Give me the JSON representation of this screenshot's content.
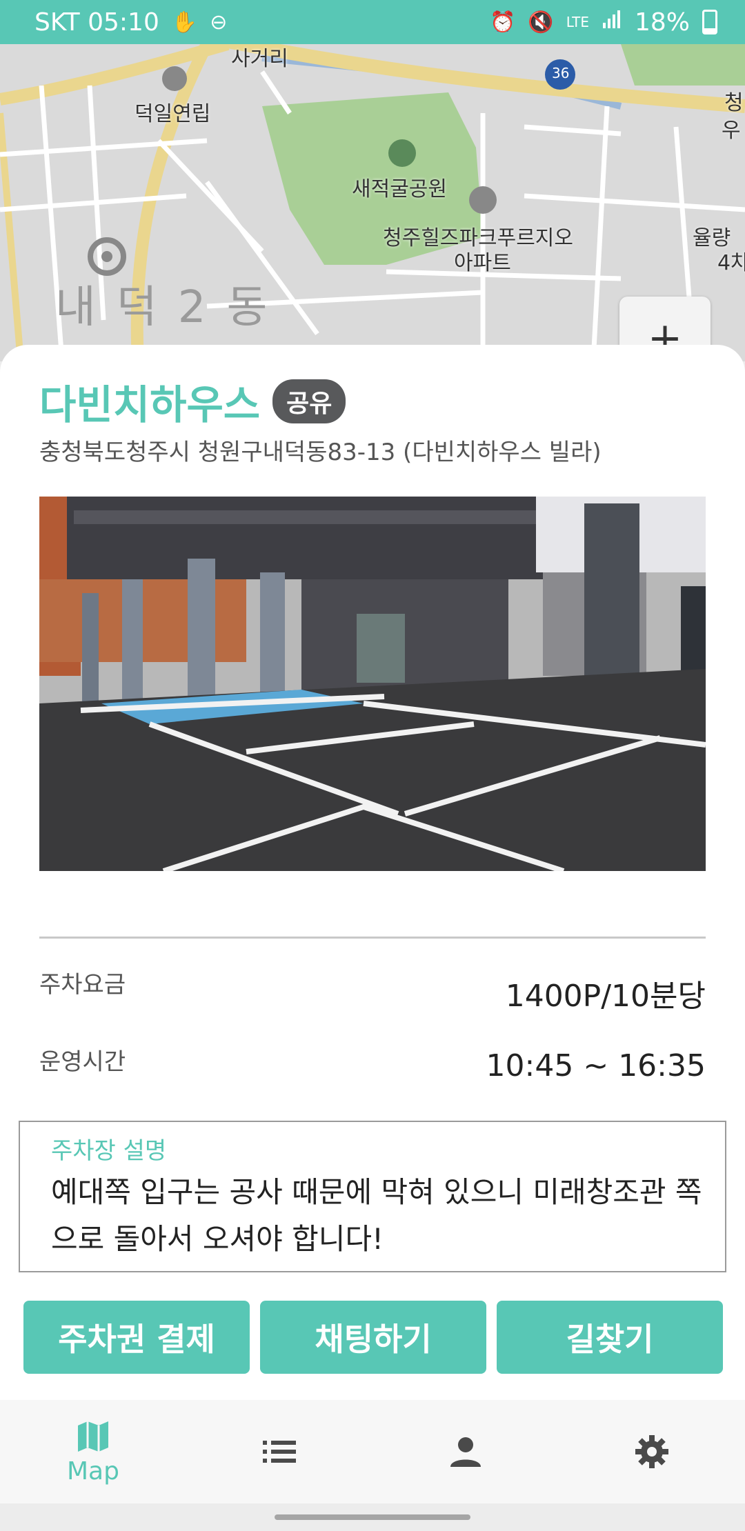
{
  "status_bar": {
    "carrier_time": "SKT 05:10",
    "signal": "LTE",
    "battery": "18%",
    "icons": [
      "hand-icon",
      "dnd-icon",
      "alarm-icon",
      "mute-icon",
      "lte-icon",
      "signal-icon",
      "battery-icon"
    ]
  },
  "map": {
    "labels": {
      "intersection": "사거리",
      "deokil": "덕일연립",
      "park": "새적굴공원",
      "apt_line1": "청주힐즈파크푸르지오",
      "apt_line2": "아파트",
      "district": "내덕2동",
      "right_top": "청",
      "right_top2": "우",
      "yullyang": "율량",
      "yullyang2": "4차",
      "road_number": "36"
    },
    "zoom_in": "+"
  },
  "parking": {
    "name": "다빈치하우스",
    "badge": "공유",
    "address": "충청북도청주시 청원구내덕동83-13 (다빈치하우스 빌라)",
    "fee_label": "주차요금",
    "fee_value": "1400P/10분당",
    "hours_label": "운영시간",
    "hours_value": "10:45 ~ 16:35",
    "desc_title": "주차장 설명",
    "desc_text": "예대쪽 입구는 공사 때문에 막혀 있으니 미래창조관 쪽으로 돌아서 오셔야 합니다!"
  },
  "actions": {
    "pay": "주차권 결제",
    "chat": "채팅하기",
    "directions": "길찾기"
  },
  "nav": {
    "map_label": "Map",
    "items": [
      "map-icon",
      "list-icon",
      "person-icon",
      "gear-icon"
    ]
  },
  "colors": {
    "accent": "#58c7b5",
    "badge": "#58595b"
  }
}
